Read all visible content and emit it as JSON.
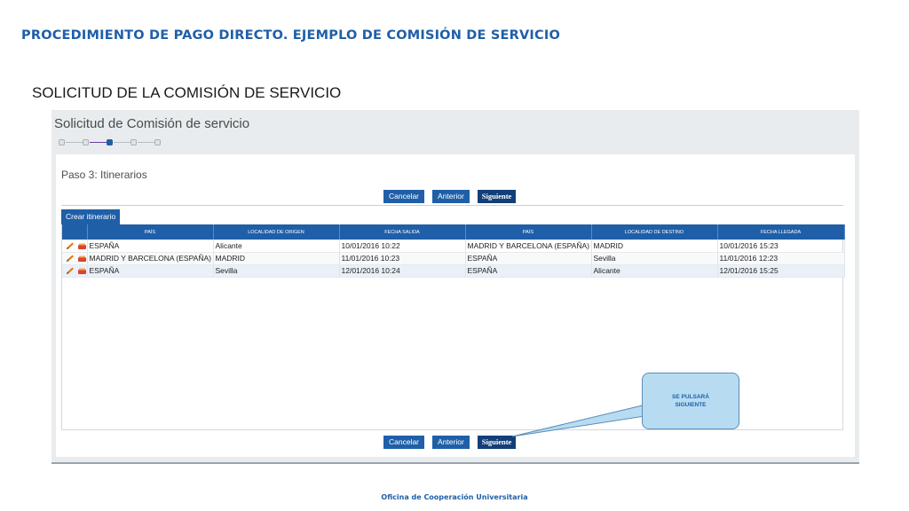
{
  "slide": {
    "title": "PROCEDIMIENTO DE PAGO DIRECTO. EJEMPLO DE COMISIÓN DE SERVICIO",
    "section_title": "SOLICITUD DE LA COMISIÓN DE SERVICIO",
    "footer": "Oficina de Cooperación Universitaria"
  },
  "app": {
    "title": "Solicitud de Comisión de servicio",
    "stepper": {
      "total_steps": 5,
      "current_step": 3
    },
    "step_title": "Paso 3: Itinerarios",
    "buttons": {
      "cancel": "Cancelar",
      "previous": "Anterior",
      "next": "Siguiente"
    },
    "create_tab": "Crear itinerario",
    "grid": {
      "columns": [
        "PAÍS",
        "LOCALIDAD DE ORIGEN",
        "FECHA SALIDA",
        "PAÍS",
        "LOCALIDAD DE DESTINO",
        "FECHA LLEGADA"
      ],
      "rows": [
        {
          "pais_origen": "ESPAÑA",
          "localidad_origen": "Alicante",
          "fecha_salida": "10/01/2016 10:22",
          "pais_destino": "MADRID Y BARCELONA (ESPAÑA)",
          "localidad_destino": "MADRID",
          "fecha_llegada": "10/01/2016 15:23"
        },
        {
          "pais_origen": "MADRID Y BARCELONA (ESPAÑA)",
          "localidad_origen": "MADRID",
          "fecha_salida": "11/01/2016 10:23",
          "pais_destino": "ESPAÑA",
          "localidad_destino": "Sevilla",
          "fecha_llegada": "11/01/2016 12:23"
        },
        {
          "pais_origen": "ESPAÑA",
          "localidad_origen": "Sevilla",
          "fecha_salida": "12/01/2016 10:24",
          "pais_destino": "ESPAÑA",
          "localidad_destino": "Alicante",
          "fecha_llegada": "12/01/2016 15:25"
        }
      ],
      "row_icons": [
        "pencil-icon",
        "delete-icon"
      ]
    }
  },
  "callout": {
    "line1": "SE PULSARÁ",
    "line2": "SIGUIENTE"
  },
  "colors": {
    "brand_blue": "#1f5fa8",
    "button_dark": "#123f78",
    "callout_fill": "#b7dcf2"
  }
}
